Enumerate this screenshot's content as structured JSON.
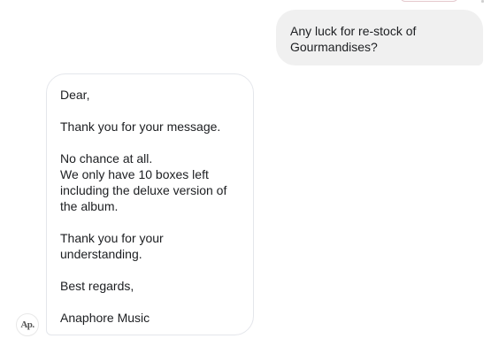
{
  "conversation": {
    "outgoing_message": {
      "text": "Any luck for re-stock of\nGourmandises?"
    },
    "incoming_message": {
      "paragraphs": [
        "Dear,",
        "Thank you for your message.",
        "No chance at all.\nWe only have 10 boxes left\nincluding the deluxe version of\nthe album.",
        "Thank you for your\nunderstanding.",
        "Best regards,",
        "Anaphore Music"
      ]
    },
    "sender_avatar": {
      "initials": "Ap.",
      "name": "Anaphore Music"
    }
  },
  "colors": {
    "outgoing_bubble": "#f0f0f0",
    "incoming_border": "#e4e6eb",
    "text": "#1c1e21"
  }
}
